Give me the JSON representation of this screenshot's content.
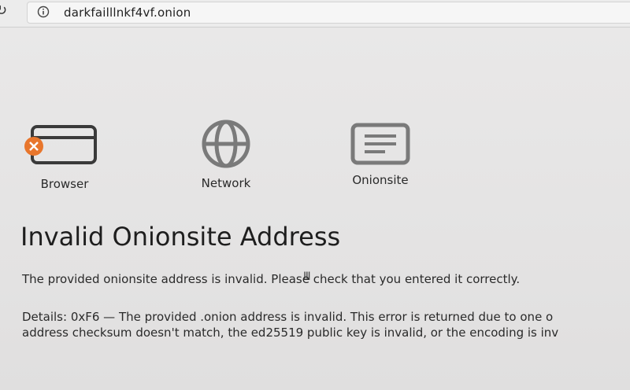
{
  "browser": {
    "url": "darkfailllnkf4vf.onion",
    "reload_icon": "reload-icon",
    "info_icon": "info-icon"
  },
  "steps": [
    {
      "label": "Browser",
      "icon": "browser-window-icon",
      "status": "error"
    },
    {
      "label": "Network",
      "icon": "globe-icon",
      "status": "ok"
    },
    {
      "label": "Onionsite",
      "icon": "onionsite-document-icon",
      "status": "ok"
    }
  ],
  "error": {
    "title": "Invalid Onionsite Address",
    "description": "The provided onionsite address is invalid. Please check that you entered it correctly.",
    "details_line1": "Details: 0xF6 — The provided .onion address is invalid. This error is returned due to one o",
    "details_line2": "address checksum doesn't match, the ed25519 public key is invalid, or the encoding is inv"
  },
  "colors": {
    "error_badge": "#e8762c",
    "icon_stroke": "#3a3a3a",
    "icon_gray": "#7a7a7a"
  }
}
